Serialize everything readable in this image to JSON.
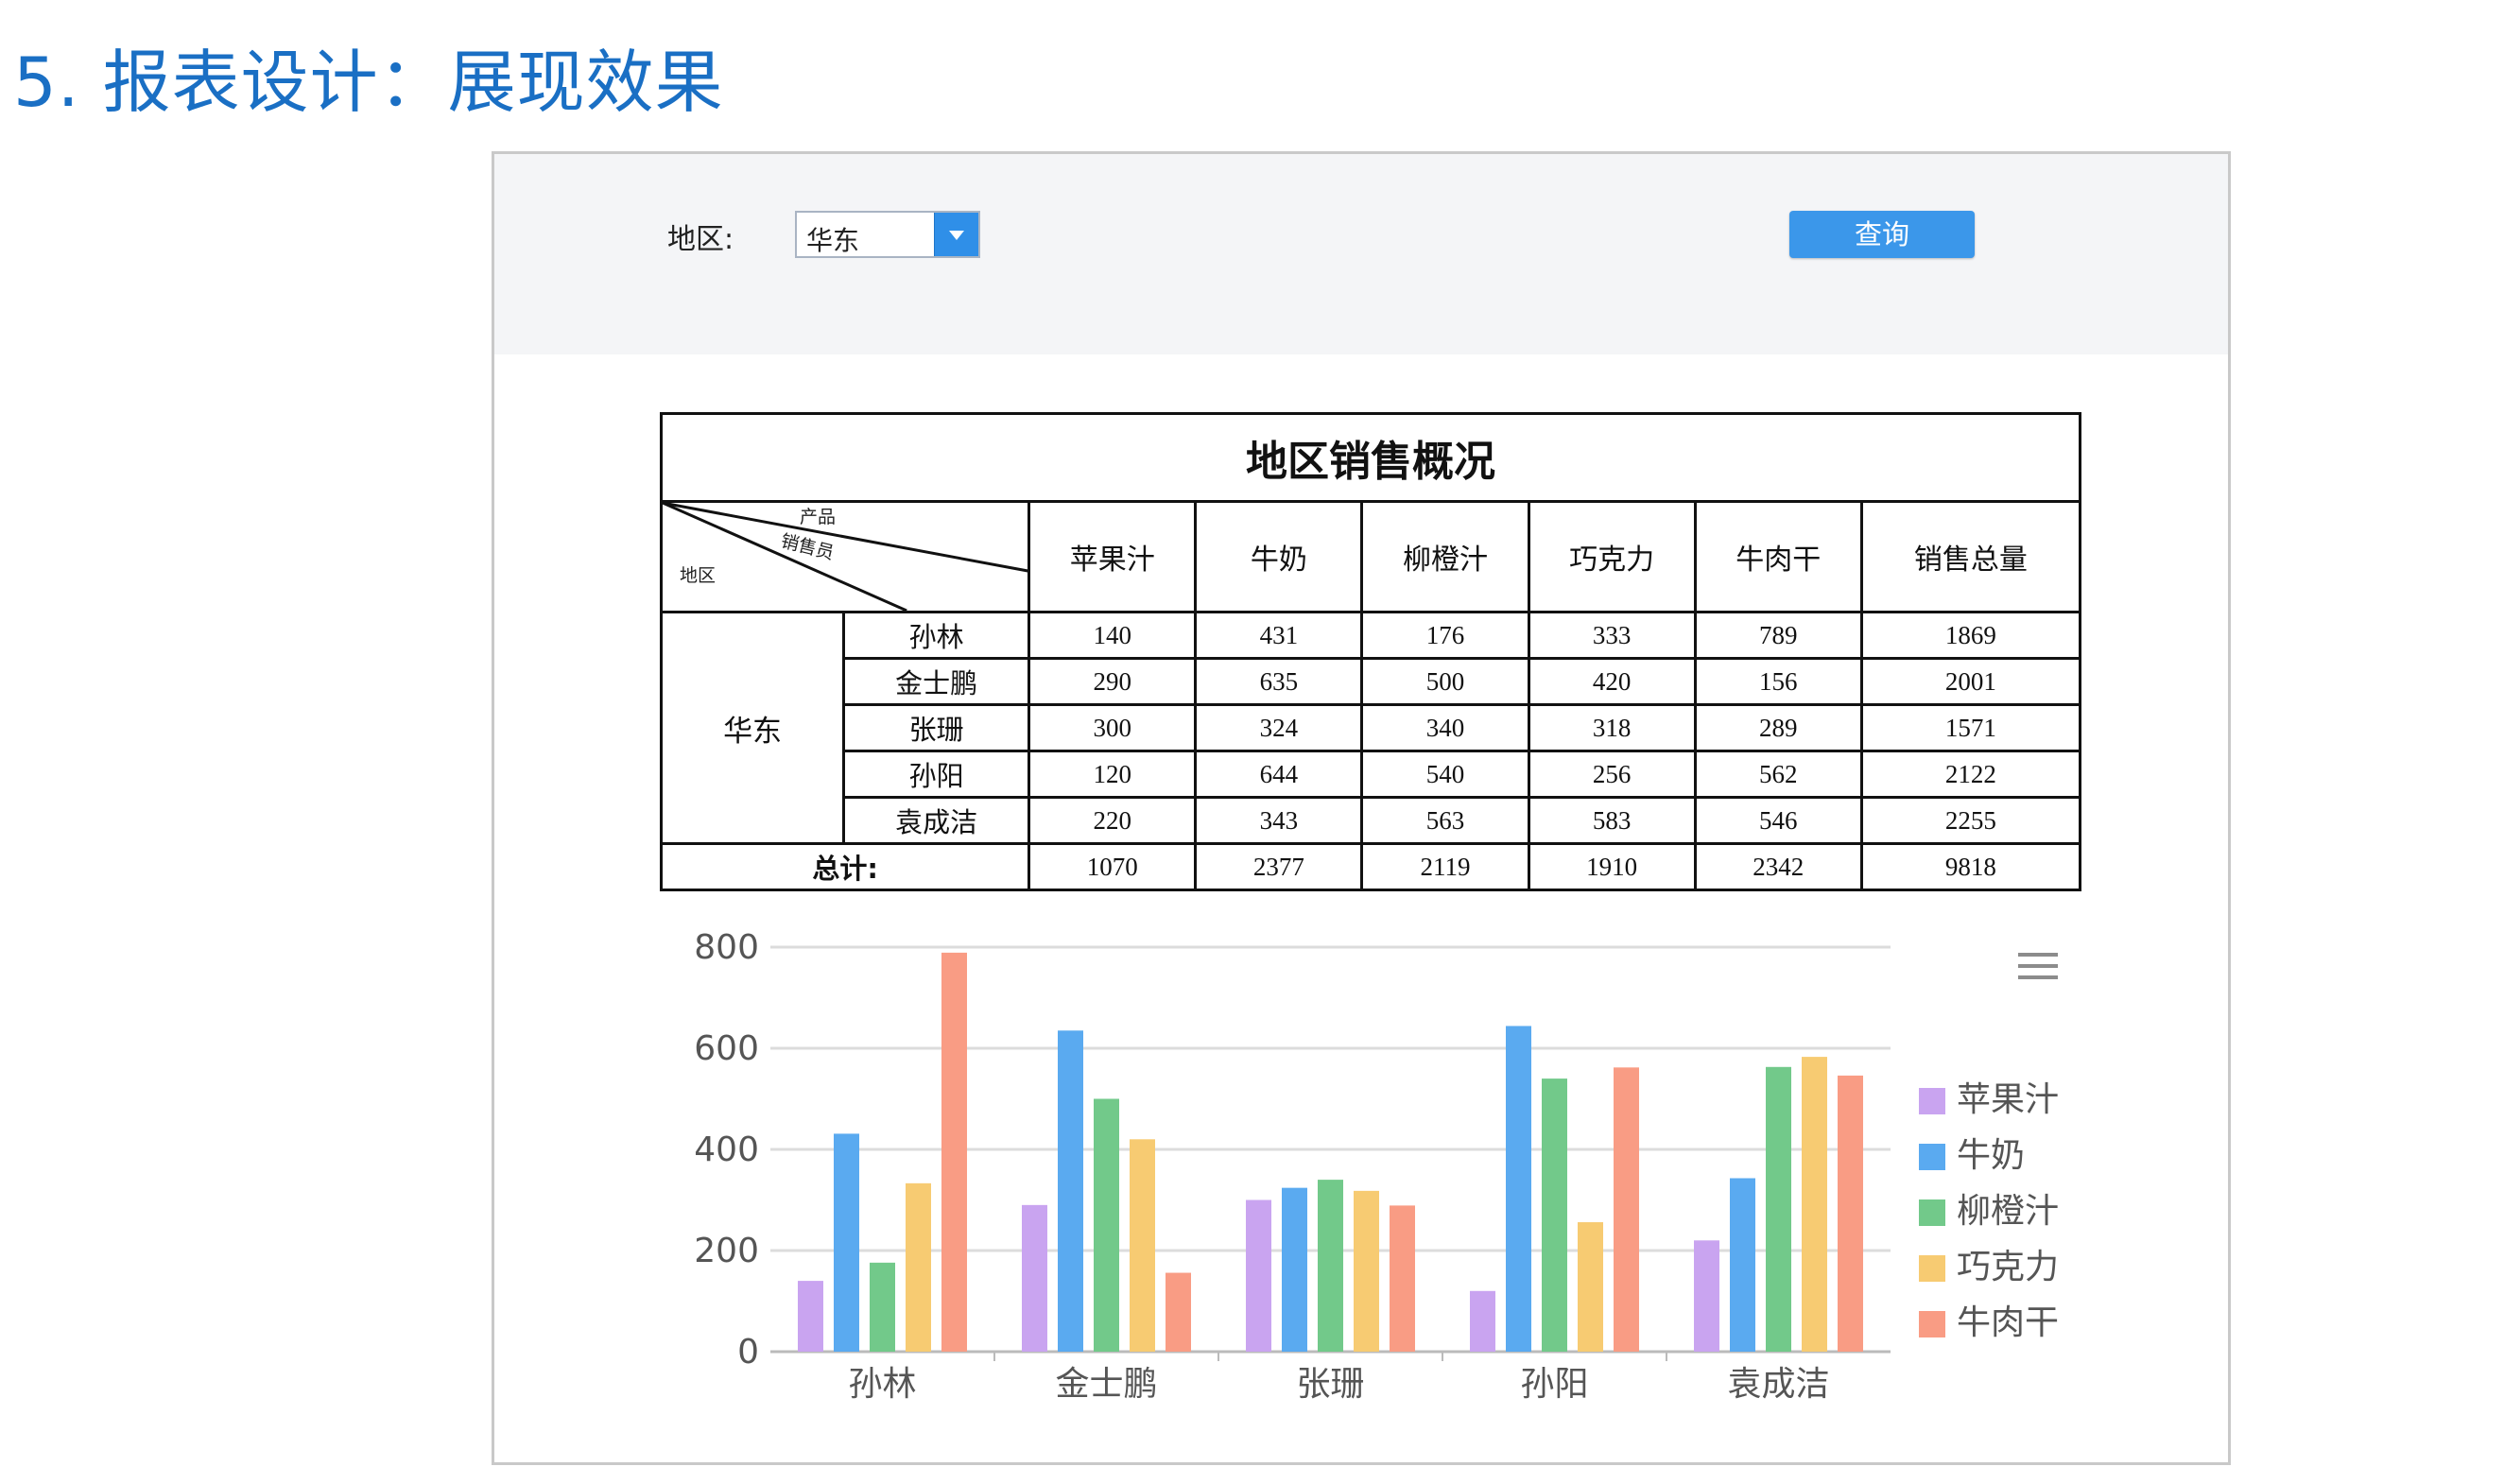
{
  "slide": {
    "title": "5. 报表设计：展现效果"
  },
  "params": {
    "region_label": "地区:",
    "region_value": "华东",
    "query_label": "查询"
  },
  "report": {
    "title": "地区销售概况",
    "corner": {
      "top": "产品",
      "middle": "销售员",
      "bottom": "地区"
    },
    "columns": [
      "苹果汁",
      "牛奶",
      "柳橙汁",
      "巧克力",
      "牛肉干",
      "销售总量"
    ],
    "region": "华东",
    "rows": [
      {
        "name": "孙林",
        "values": [
          "140",
          "431",
          "176",
          "333",
          "789",
          "1869"
        ]
      },
      {
        "name": "金士鹏",
        "values": [
          "290",
          "635",
          "500",
          "420",
          "156",
          "2001"
        ]
      },
      {
        "name": "张珊",
        "values": [
          "300",
          "324",
          "340",
          "318",
          "289",
          "1571"
        ]
      },
      {
        "name": "孙阳",
        "values": [
          "120",
          "644",
          "540",
          "256",
          "562",
          "2122"
        ]
      },
      {
        "name": "袁成洁",
        "values": [
          "220",
          "343",
          "563",
          "583",
          "546",
          "2255"
        ]
      }
    ],
    "total_label": "总计:",
    "totals": [
      "1070",
      "2377",
      "2119",
      "1910",
      "2342",
      "9818"
    ]
  },
  "chart_data": {
    "type": "bar",
    "categories": [
      "孙林",
      "金士鹏",
      "张珊",
      "孙阳",
      "袁成洁"
    ],
    "series": [
      {
        "name": "苹果汁",
        "color": "#c9a4f0",
        "values": [
          140,
          290,
          300,
          120,
          220
        ]
      },
      {
        "name": "牛奶",
        "color": "#5aaaf0",
        "values": [
          431,
          635,
          324,
          644,
          343
        ]
      },
      {
        "name": "柳橙汁",
        "color": "#72c98a",
        "values": [
          176,
          500,
          340,
          540,
          563
        ]
      },
      {
        "name": "巧克力",
        "color": "#f7cb72",
        "values": [
          333,
          420,
          318,
          256,
          583
        ]
      },
      {
        "name": "牛肉干",
        "color": "#f99c84",
        "values": [
          789,
          156,
          289,
          562,
          546
        ]
      }
    ],
    "y_ticks": [
      "0",
      "200",
      "400",
      "600",
      "800"
    ],
    "ylim": [
      0,
      800
    ],
    "grid": true,
    "legend_position": "right",
    "title": "",
    "xlabel": "",
    "ylabel": ""
  },
  "icons": {
    "chart_menu": "hamburger-menu-icon"
  }
}
